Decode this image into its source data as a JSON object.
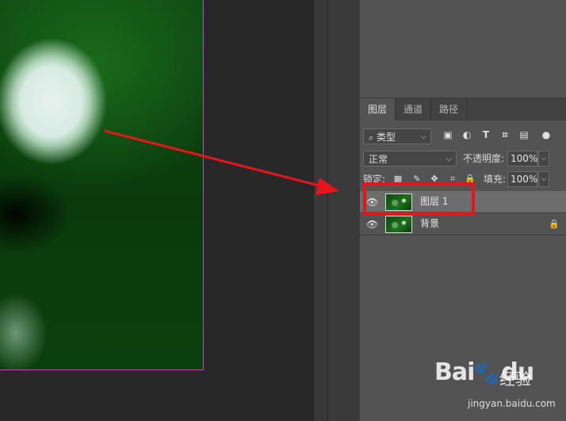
{
  "tabs": [
    {
      "label": "图层",
      "active": true
    },
    {
      "label": "通道",
      "active": false
    },
    {
      "label": "路径",
      "active": false
    }
  ],
  "filter": {
    "search_icon": "search-icon",
    "label": "类型"
  },
  "filter_icons": [
    "image-filter-icon",
    "adjustment-filter-icon",
    "type-filter-icon",
    "shape-filter-icon",
    "smart-object-filter-icon",
    "toggle-filter-icon"
  ],
  "blend": {
    "mode": "正常",
    "opacity_label": "不透明度:",
    "opacity_value": "100%"
  },
  "lock": {
    "label": "锁定:",
    "fill_label": "填充:",
    "fill_value": "100%"
  },
  "layers": [
    {
      "name": "图层 1",
      "selected": true,
      "locked": false
    },
    {
      "name": "背景",
      "selected": false,
      "locked": true
    }
  ],
  "watermark": {
    "brand": "Bai",
    "brand_du": "du",
    "sub": "经验",
    "url": "jingyan.baidu.com"
  },
  "colors": {
    "highlight": "#e8141c",
    "panel_bg": "#535353",
    "canvas_bg": "#282828",
    "doc_border": "#c04ac0"
  }
}
